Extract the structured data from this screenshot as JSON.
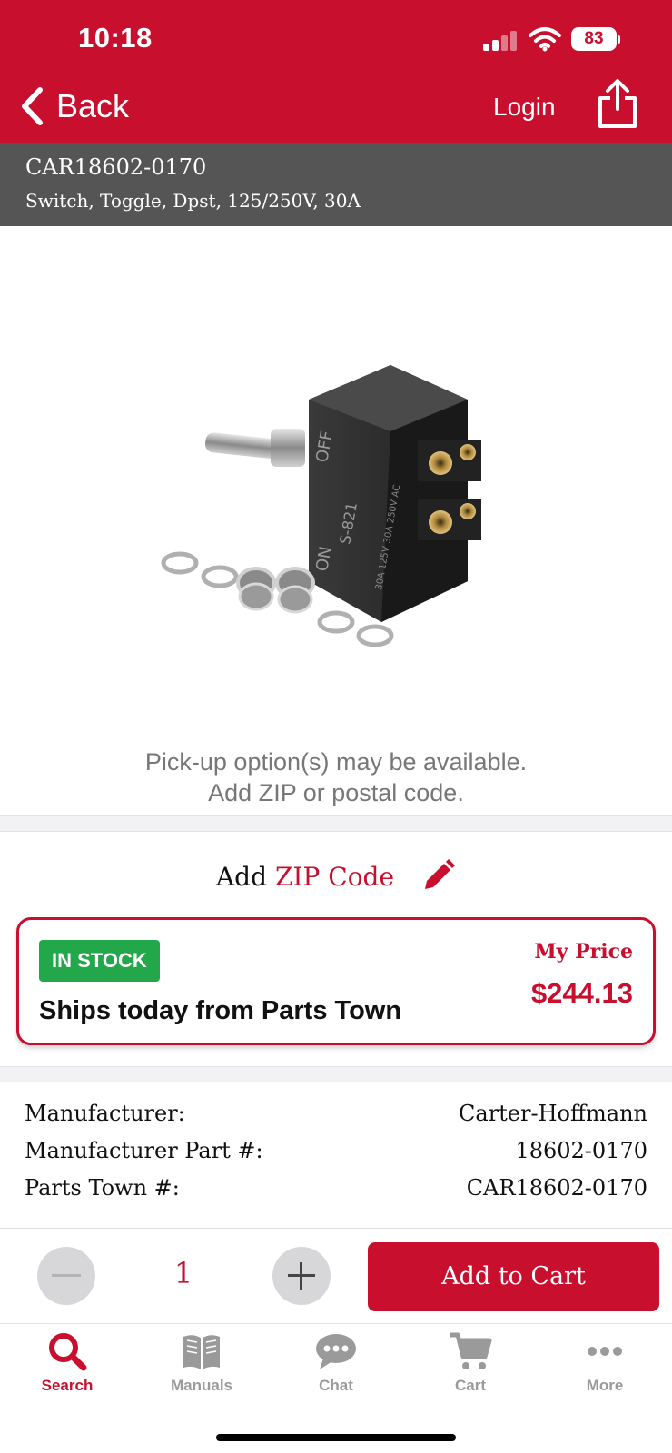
{
  "status_bar": {
    "time": "10:18",
    "battery": "83"
  },
  "header": {
    "back_label": "Back",
    "login_label": "Login"
  },
  "product": {
    "code": "CAR18602-0170",
    "description": "Switch, Toggle, Dpst, 125/250V, 30A",
    "image_markings": {
      "off": "OFF",
      "on": "ON",
      "model": "S-821",
      "rating": "30A 125V 30A 250V AC"
    }
  },
  "pickup": {
    "line1": "Pick-up option(s) may be available.",
    "line2": "Add ZIP or postal code."
  },
  "zip": {
    "prefix": "Add",
    "link": "ZIP Code"
  },
  "stock": {
    "badge": "IN STOCK",
    "ships": "Ships today from Parts Town",
    "price_label": "My Price",
    "price": "$244.13"
  },
  "details": [
    {
      "label": "Manufacturer:",
      "value": "Carter-Hoffmann"
    },
    {
      "label": "Manufacturer Part #:",
      "value": "18602-0170"
    },
    {
      "label": "Parts Town #:",
      "value": "CAR18602-0170"
    }
  ],
  "cart": {
    "quantity": "1",
    "add_label": "Add to Cart"
  },
  "tabs": [
    {
      "label": "Search",
      "icon": "search-icon"
    },
    {
      "label": "Manuals",
      "icon": "book-icon"
    },
    {
      "label": "Chat",
      "icon": "chat-icon"
    },
    {
      "label": "Cart",
      "icon": "cart-icon"
    },
    {
      "label": "More",
      "icon": "more-icon"
    }
  ],
  "colors": {
    "brand": "#c8102e",
    "in_stock": "#22a84a",
    "subheader": "#555555"
  }
}
